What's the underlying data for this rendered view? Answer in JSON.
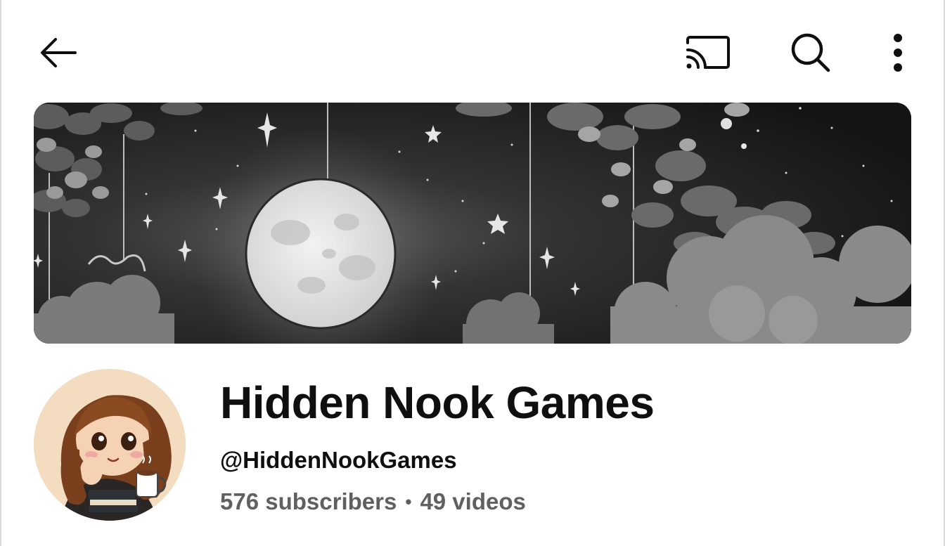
{
  "topbar": {
    "icons": {
      "back": "arrow-left-icon",
      "cast": "cast-icon",
      "search": "search-icon",
      "more": "more-vertical-icon"
    }
  },
  "banner": {
    "description_icon": "night-moon-banner"
  },
  "channel": {
    "name": "Hidden Nook Games",
    "handle": "@HiddenNookGames",
    "subscribers": "576 subscribers",
    "separator": "•",
    "videos": "49 videos"
  },
  "colors": {
    "text_primary": "#0f0f0f",
    "text_secondary": "#606060",
    "background": "#ffffff"
  }
}
